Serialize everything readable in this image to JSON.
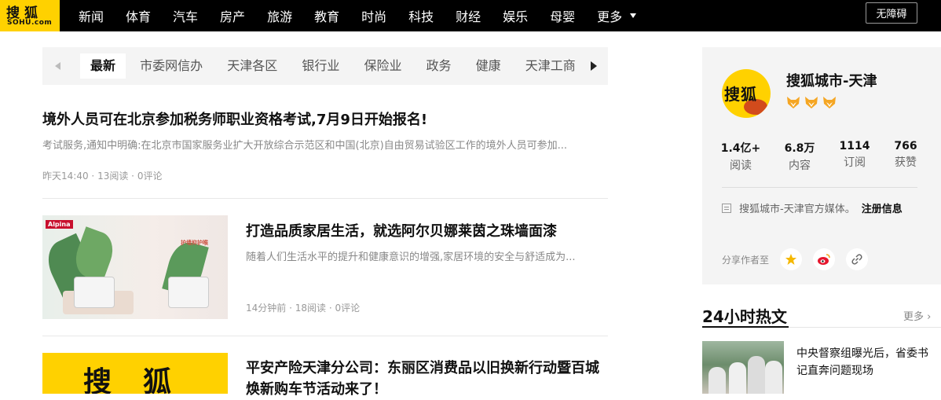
{
  "nav": {
    "logo_cn": "搜狐",
    "logo_en": "SOHU.com",
    "items": [
      "新闻",
      "体育",
      "汽车",
      "房产",
      "旅游",
      "教育",
      "时尚",
      "科技",
      "财经",
      "娱乐",
      "母婴"
    ],
    "more_label": "更多",
    "accessibility_label": "无障碍"
  },
  "tabs": [
    "最新",
    "市委网信办",
    "天津各区",
    "银行业",
    "保险业",
    "政务",
    "健康",
    "天津工商"
  ],
  "articles": [
    {
      "title": "境外人员可在北京参加税务师职业资格考试,7月9日开始报名!",
      "summary": "考试服务,通知中明确:在北京市国家服务业扩大开放综合示范区和中国(北京)自由贸易试验区工作的境外人员可参加...",
      "time": "昨天14:40",
      "reads": "13阅读",
      "comments": "0评论"
    },
    {
      "title": "打造品质家居生活，就选阿尔贝娜莱茵之珠墙面漆",
      "summary": "随着人们生活水平的提升和健康意识的增强,家居环境的安全与舒适成为...",
      "time": "14分钟前",
      "reads": "18阅读",
      "comments": "0评论",
      "thumb_brand": "Alpina",
      "thumb_caption": "护墙抑护喉"
    },
    {
      "title": "平安产险天津分公司：东丽区消费品以旧换新行动暨百城焕新购车节活动来了！",
      "thumb_text": "搜狐"
    }
  ],
  "author": {
    "avatar_text": "搜狐",
    "name": "搜狐城市-天津",
    "stats": [
      {
        "value": "1.4亿+",
        "label": "阅读"
      },
      {
        "value": "6.8万",
        "label": "内容"
      },
      {
        "value": "1114",
        "label": "订阅"
      },
      {
        "value": "766",
        "label": "获赞"
      }
    ],
    "description": "搜狐城市-天津官方媒体。",
    "register_label": "注册信息",
    "share_label": "分享作者至"
  },
  "hot": {
    "title": "24小时热文",
    "more_label": "更多",
    "items": [
      {
        "title": "中央督察组曝光后，省委书记直奔问题现场"
      }
    ]
  },
  "colors": {
    "brand_yellow": "#ffd100",
    "nav_bg": "#000000",
    "tab_bg": "#f4f4f4",
    "card_bg": "#f4f4f4"
  }
}
